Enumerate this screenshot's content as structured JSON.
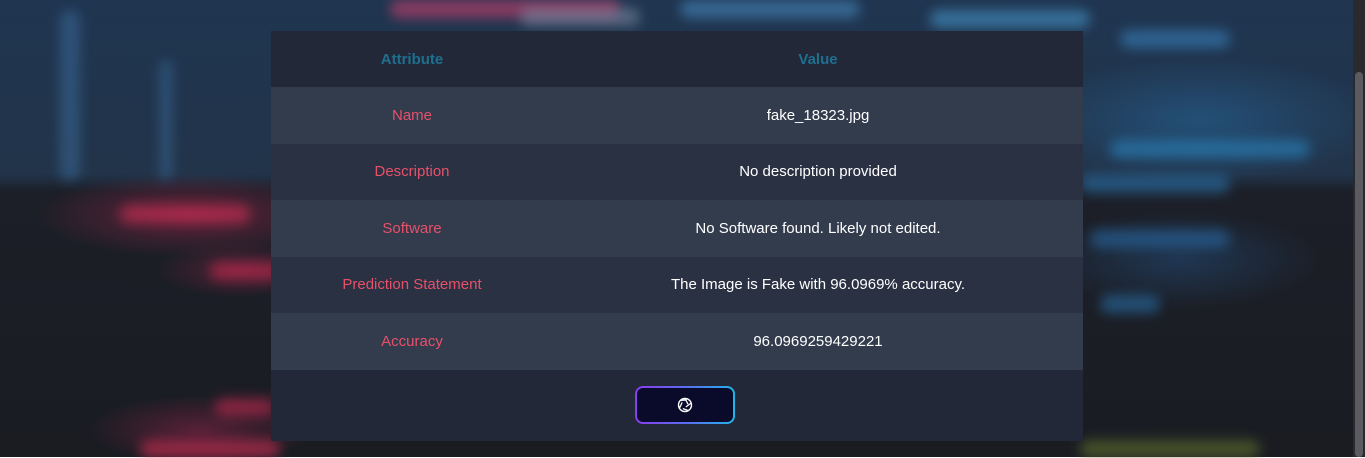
{
  "table": {
    "headers": [
      "Attribute",
      "Value"
    ],
    "rows": [
      {
        "attribute": "Name",
        "value": "fake_18323.jpg"
      },
      {
        "attribute": "Description",
        "value": "No description provided"
      },
      {
        "attribute": "Software",
        "value": "No Software found. Likely not edited."
      },
      {
        "attribute": "Prediction Statement",
        "value": "The Image is Fake with 96.0969% accuracy."
      },
      {
        "attribute": "Accuracy",
        "value": "96.0969259429221"
      }
    ]
  },
  "action_button": {
    "icon": "aperture-icon"
  },
  "colors": {
    "header_text": "#1f6f8f",
    "attribute_text": "#e8506a",
    "value_text": "#ffffff",
    "button_gradient_start": "#8a3cf0",
    "button_gradient_end": "#22b4e8"
  }
}
